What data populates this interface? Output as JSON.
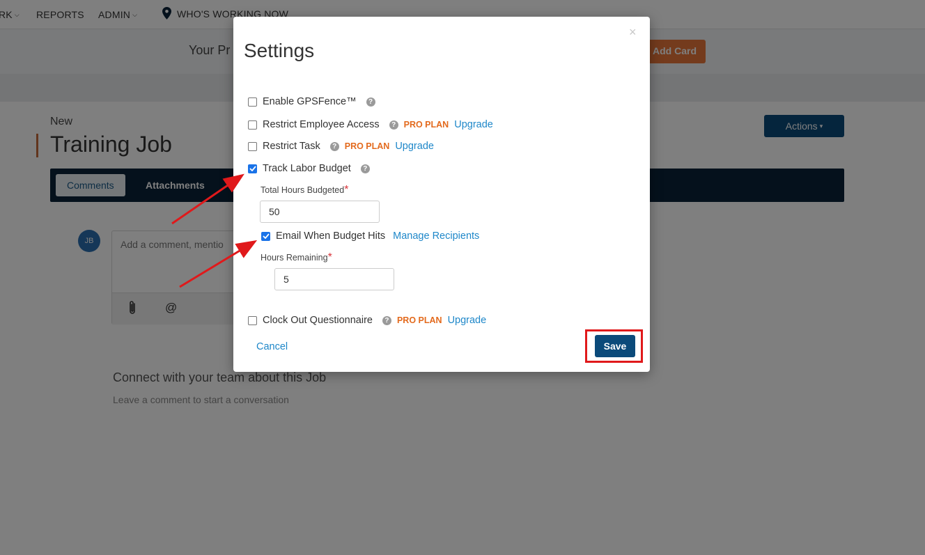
{
  "topnav": {
    "items": [
      {
        "label": "RK",
        "dropdown": true
      },
      {
        "label": "REPORTS",
        "dropdown": false
      },
      {
        "label": "ADMIN",
        "dropdown": true
      },
      {
        "label": "WHO'S WORKING NOW",
        "dropdown": false
      }
    ]
  },
  "subbar": {
    "text": "Your Pr",
    "add_card_label": "Add Card"
  },
  "job": {
    "status": "New",
    "title": "Training Job",
    "actions_label": "Actions"
  },
  "tabs": [
    {
      "label": "Comments",
      "active": true
    },
    {
      "label": "Attachments",
      "active": false
    }
  ],
  "comment": {
    "avatar_initials": "JB",
    "placeholder": "Add a comment, mentio"
  },
  "empty_state": {
    "title": "Connect with your team about this Job",
    "subtitle": "Leave a comment to start a conversation"
  },
  "modal": {
    "title": "Settings",
    "close_symbol": "×",
    "options": [
      {
        "label": "Enable GPSFence™",
        "checked": false,
        "pro": "",
        "upgrade": ""
      },
      {
        "label": "Restrict Employee Access",
        "checked": false,
        "pro": "PRO PLAN",
        "upgrade": "Upgrade"
      },
      {
        "label": "Restrict Task",
        "checked": false,
        "pro": "PRO PLAN",
        "upgrade": "Upgrade"
      },
      {
        "label": "Track Labor Budget",
        "checked": true,
        "pro": "",
        "upgrade": ""
      }
    ],
    "total_hours": {
      "label": "Total Hours Budgeted",
      "required": "*",
      "value": "50"
    },
    "email_budget": {
      "label": "Email When Budget Hits",
      "checked": true,
      "link": "Manage Recipients"
    },
    "hours_remaining": {
      "label": "Hours Remaining",
      "required": "*",
      "value": "5"
    },
    "clock_out": {
      "label": "Clock Out Questionnaire",
      "checked": false,
      "pro": "PRO PLAN",
      "upgrade": "Upgrade"
    },
    "cancel_label": "Cancel",
    "save_label": "Save"
  },
  "colors": {
    "primary": "#0b4a7a",
    "accent": "#e8773a",
    "pro_plan": "#e36a1d",
    "link": "#1e87c9",
    "annotation": "#e0191b",
    "checkbox_checked": "#1a73e8"
  }
}
